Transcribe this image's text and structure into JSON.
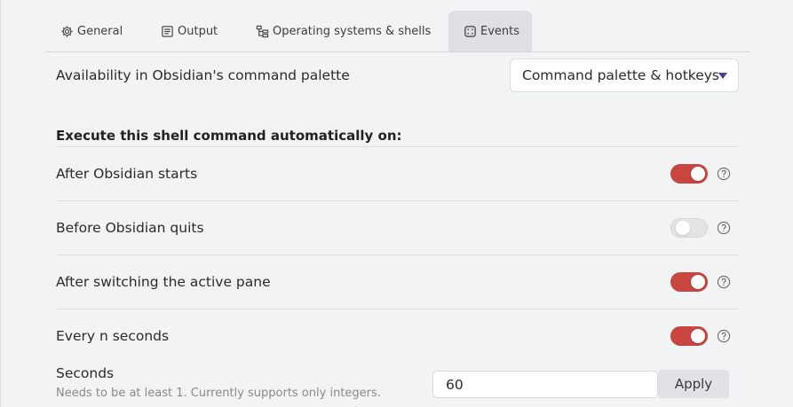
{
  "tabs": [
    {
      "label": "General",
      "icon": "gear-icon",
      "active": false
    },
    {
      "label": "Output",
      "icon": "output-icon",
      "active": false
    },
    {
      "label": "Operating systems & shells",
      "icon": "tree-icon",
      "active": false
    },
    {
      "label": "Events",
      "icon": "dice-icon",
      "active": true
    }
  ],
  "palette": {
    "label": "Availability in Obsidian's command palette",
    "value": "Command palette & hotkeys"
  },
  "events": {
    "heading": "Execute this shell command automatically on:",
    "items": [
      {
        "label": "After Obsidian starts",
        "enabled": true
      },
      {
        "label": "Before Obsidian quits",
        "enabled": false
      },
      {
        "label": "After switching the active pane",
        "enabled": true
      },
      {
        "label": "Every n seconds",
        "enabled": true
      }
    ]
  },
  "seconds": {
    "label": "Seconds",
    "description": "Needs to be at least 1. Currently supports only integers.",
    "value": "60",
    "apply_label": "Apply"
  },
  "colors": {
    "accent": "#c9453f",
    "caret": "#4a3f8c",
    "background": "#f2f3f5"
  }
}
